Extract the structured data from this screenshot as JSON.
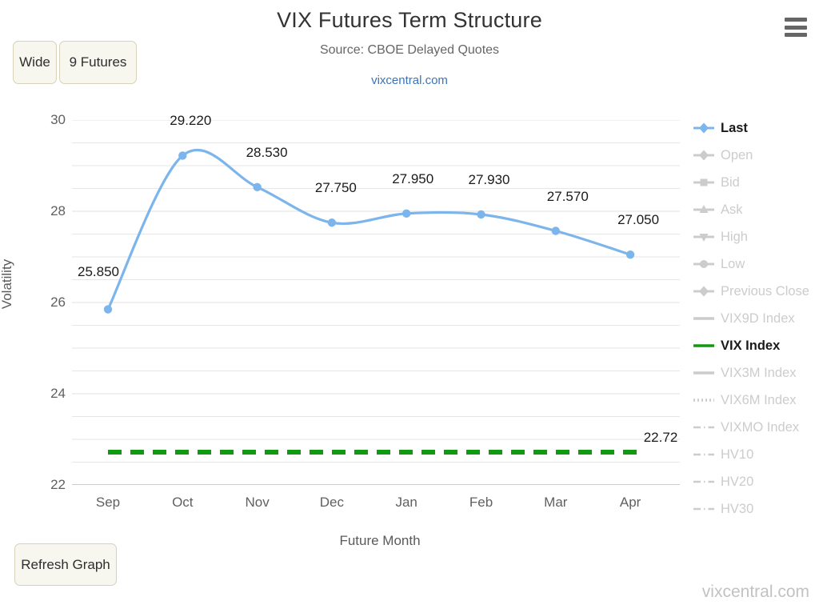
{
  "header": {
    "title": "VIX Futures Term Structure",
    "subtitle": "Source: CBOE Delayed Quotes",
    "link": "vixcentral.com"
  },
  "toolbar": {
    "wide_label": "Wide",
    "count_label": "9 Futures",
    "refresh_label": "Refresh Graph",
    "menu_icon": "hamburger-icon"
  },
  "footer": {
    "watermark": "vixcentral.com"
  },
  "colors": {
    "series_last": "#7cb5ec",
    "vix_index": "#119911",
    "gridline": "#e6e6e6",
    "axis_line": "#c0d0e8",
    "legend_inactive": "#cccccc",
    "legend_active": "#1a1a1a",
    "button_bg": "#f8f7ef",
    "button_border": "#d7d1b8",
    "link": "#3b73b9"
  },
  "legend": {
    "items": [
      {
        "label": "Last",
        "symbol": "diamond-marker-icon",
        "active": true,
        "color": "#7cb5ec"
      },
      {
        "label": "Open",
        "symbol": "diamond-marker-icon",
        "active": false,
        "color": "#cccccc"
      },
      {
        "label": "Bid",
        "symbol": "square-marker-icon",
        "active": false,
        "color": "#cccccc"
      },
      {
        "label": "Ask",
        "symbol": "triangle-up-marker-icon",
        "active": false,
        "color": "#cccccc"
      },
      {
        "label": "High",
        "symbol": "triangle-down-marker-icon",
        "active": false,
        "color": "#cccccc"
      },
      {
        "label": "Low",
        "symbol": "circle-marker-icon",
        "active": false,
        "color": "#cccccc"
      },
      {
        "label": "Previous Close",
        "symbol": "diamond-marker-icon",
        "active": false,
        "color": "#cccccc"
      },
      {
        "label": "VIX9D Index",
        "symbol": "solid-line-icon",
        "active": false,
        "color": "#cccccc"
      },
      {
        "label": "VIX Index",
        "symbol": "solid-line-icon",
        "active": true,
        "color": "#119911"
      },
      {
        "label": "VIX3M Index",
        "symbol": "solid-line-icon",
        "active": false,
        "color": "#cccccc"
      },
      {
        "label": "VIX6M Index",
        "symbol": "dotted-line-icon",
        "active": false,
        "color": "#cccccc"
      },
      {
        "label": "VIXMO Index",
        "symbol": "dash-dot-line-icon",
        "active": false,
        "color": "#cccccc"
      },
      {
        "label": "HV10",
        "symbol": "dash-dot-line-icon",
        "active": false,
        "color": "#cccccc"
      },
      {
        "label": "HV20",
        "symbol": "dash-dot-line-icon",
        "active": false,
        "color": "#cccccc"
      },
      {
        "label": "HV30",
        "symbol": "dash-dot-line-icon",
        "active": false,
        "color": "#cccccc"
      }
    ]
  },
  "chart_data": {
    "type": "line",
    "title": "VIX Futures Term Structure",
    "subtitle": "Source: CBOE Delayed Quotes",
    "xlabel": "Future Month",
    "ylabel": "Volatility",
    "categories": [
      "Sep",
      "Oct",
      "Nov",
      "Dec",
      "Jan",
      "Feb",
      "Mar",
      "Apr"
    ],
    "ylim": [
      22,
      30
    ],
    "yticks": [
      22,
      24,
      26,
      28,
      30
    ],
    "ytick_labels": [
      "22",
      "24",
      "26",
      "28",
      "30"
    ],
    "minor_gridline_step": 0.5,
    "grid": true,
    "legend_position": "right",
    "series": [
      {
        "name": "Last",
        "color": "#7cb5ec",
        "type": "spline",
        "markers": true,
        "values": [
          25.85,
          29.22,
          28.53,
          27.75,
          27.95,
          27.93,
          27.57,
          27.05
        ],
        "data_labels": [
          "25.850",
          "29.220",
          "28.530",
          "27.750",
          "27.950",
          "27.930",
          "27.570",
          "27.050"
        ]
      },
      {
        "name": "VIX Index",
        "color": "#119911",
        "type": "dashed-horizontal-line",
        "value": 22.72,
        "data_label": "22.72"
      }
    ]
  }
}
